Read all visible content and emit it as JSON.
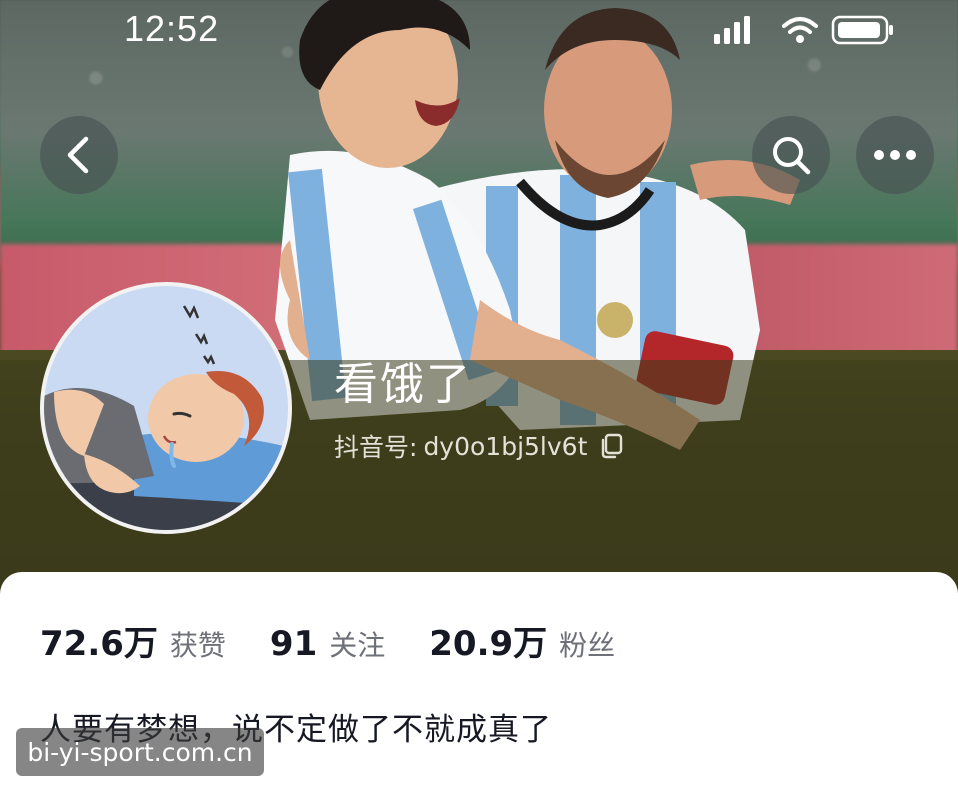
{
  "status_bar": {
    "time": "12:52",
    "icons": [
      "signal-icon",
      "wifi-icon",
      "battery-icon"
    ]
  },
  "header": {
    "back_icon": "chevron-left-icon",
    "search_icon": "search-icon",
    "more_icon": "more-horizontal-icon"
  },
  "profile": {
    "nickname": "看饿了",
    "id_label": "抖音号:",
    "id_value": "dy0o1bj5lv6t",
    "id_copy_icon": "copy-icon"
  },
  "stats": [
    {
      "value": "72.6万",
      "label": "获赞"
    },
    {
      "value": "91",
      "label": "关注"
    },
    {
      "value": "20.9万",
      "label": "粉丝"
    }
  ],
  "bio": "人要有梦想，说不定做了不就成真了",
  "watermark": "bi-yi-sport.com.cn",
  "colors": {
    "text_primary": "#161823",
    "text_secondary": "#6e707a",
    "button_bg": "rgba(70,80,80,0.62)"
  }
}
